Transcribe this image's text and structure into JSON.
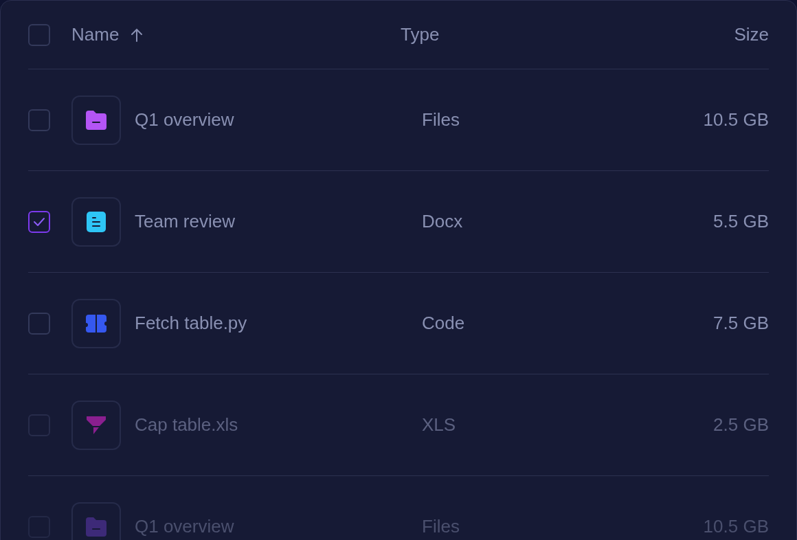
{
  "table": {
    "select_all": {
      "checked": false
    },
    "columns": [
      {
        "label": "Name",
        "sorted_ascending": true
      },
      {
        "label": "Type"
      },
      {
        "label": "Size"
      }
    ],
    "rows": [
      {
        "checked": false,
        "kind": "folder",
        "color": "#b455f5",
        "name": "Q1 overview",
        "type": "Files",
        "size": "10.5 GB"
      },
      {
        "checked": true,
        "kind": "document",
        "color": "#2ec5f5",
        "name": "Team review",
        "type": "Docx",
        "size": "5.5 GB"
      },
      {
        "checked": false,
        "kind": "code",
        "color": "#3558f0",
        "name": "Fetch table.py",
        "type": "Code",
        "size": "7.5 GB"
      },
      {
        "checked": false,
        "kind": "funnel",
        "color": "#8a1f8f",
        "name": "Cap table.xls",
        "type": "XLS",
        "size": "2.5 GB"
      },
      {
        "checked": false,
        "kind": "folder",
        "color": "#3d2a78",
        "name": "Q1 overview",
        "type": "Files",
        "size": "10.5 GB"
      }
    ]
  }
}
